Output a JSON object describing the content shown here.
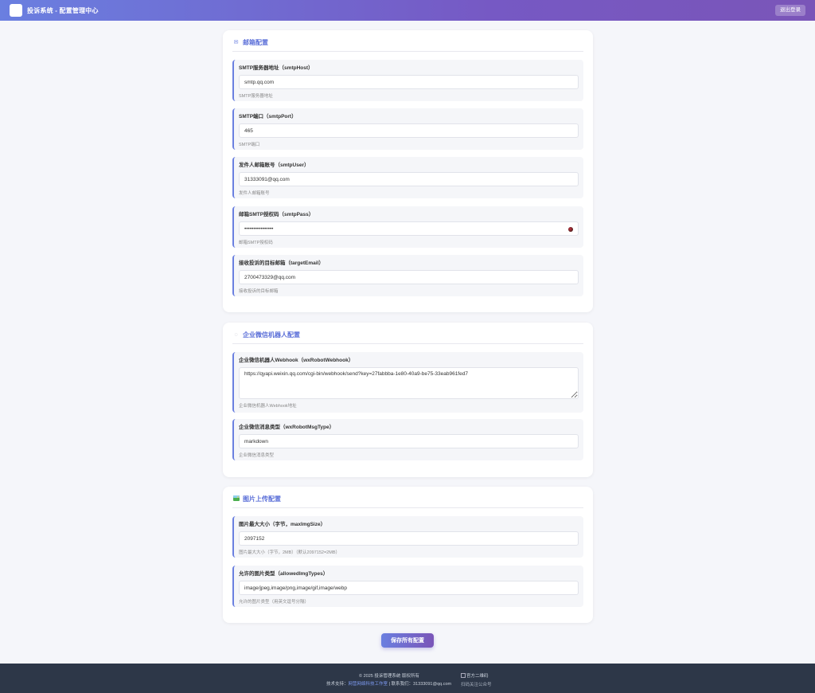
{
  "header": {
    "title": "投诉系统 - 配置管理中心",
    "logout_label": "退出登录"
  },
  "sections": {
    "email": {
      "icon": "email-icon",
      "title": "邮箱配置",
      "fields": [
        {
          "label": "SMTP服务器地址（smtpHost）",
          "value": "smtp.qq.com",
          "hint": "SMTP服务器地址"
        },
        {
          "label": "SMTP端口（smtpPort）",
          "value": "465",
          "hint": "SMTP端口"
        },
        {
          "label": "发件人邮箱账号（smtpUser）",
          "value": "31333091@qq.com",
          "hint": "发件人邮箱账号"
        },
        {
          "label": "邮箱SMTP授权码（smtpPass）",
          "value": "••••••••••••••••",
          "hint": "邮箱SMTP授权码"
        },
        {
          "label": "接收投诉的目标邮箱（targetEmail）",
          "value": "2700473329@qq.com",
          "hint": "接收投诉的目标邮箱"
        }
      ]
    },
    "wechat": {
      "icon": "robot-icon",
      "title": "企业微信机器人配置",
      "fields": [
        {
          "label": "企业微信机器人Webhook（wxRobotWebhook）",
          "value": "https://qyapi.weixin.qq.com/cgi-bin/webhook/send?key=27fabbba-1e80-40a9-be75-33eab961fed7",
          "hint": "企业微信机器人Webhook地址"
        },
        {
          "label": "企业微信消息类型（wxRobotMsgType）",
          "value": "markdown",
          "hint": "企业微信消息类型"
        }
      ]
    },
    "upload": {
      "icon": "image-icon",
      "title": "图片上传配置",
      "fields": [
        {
          "label": "图片最大大小（字节，maxImgSize）",
          "value": "2097152",
          "hint": "图片最大大小（字节，2MB）（默认2097152=2MB）"
        },
        {
          "label": "允许的图片类型（allowedImgTypes）",
          "value": "image/jpeg,image/png,image/gif,image/webp",
          "hint": "允许的图片类型（用英文逗号分隔）"
        }
      ]
    }
  },
  "save_label": "保存所有配置",
  "footer": {
    "copyright": "© 2025 投诉管理系统 版权所有",
    "support_prefix": "技术支持：",
    "support_link": "网营网络科技工作室",
    "contact": " | 联系我们：31333091@qq.com",
    "qr_alt": "官方二维码",
    "qr_caption": "扫码关注公众号"
  }
}
